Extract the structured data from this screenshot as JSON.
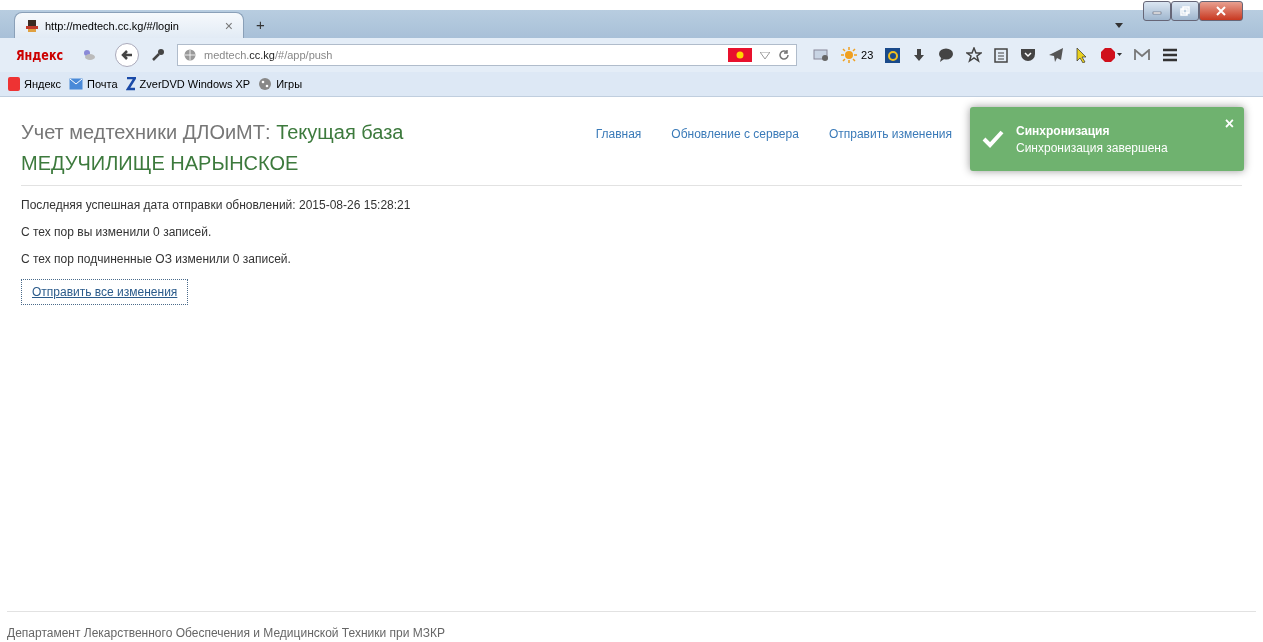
{
  "browser": {
    "tab_title": "http://medtech.cc.kg/#/login",
    "tab_close": "×",
    "new_tab": "+",
    "search_brand": "Яндекс",
    "address_host_prefix": "medtech.",
    "address_host": "cc.kg",
    "address_path": "/#/app/push",
    "weather": "23",
    "bookmarks": [
      {
        "label": "Яндекс"
      },
      {
        "label": "Почта"
      },
      {
        "label": "ZverDVD Windows XP"
      },
      {
        "label": "Игры"
      }
    ]
  },
  "header": {
    "app_title": "Учет медтехники ДЛОиМТ:",
    "base_label": "Текущая база",
    "org": "МЕДУЧИЛИЩЕ НАРЫНСКОЕ"
  },
  "nav": [
    {
      "label": "Главная"
    },
    {
      "label": "Обновление с сервера"
    },
    {
      "label": "Отправить изменения"
    }
  ],
  "content": {
    "lines": [
      "Последняя успешная дата отправки обновлений: 2015-08-26 15:28:21",
      "С тех пор вы изменили 0 записей.",
      "С тех пор подчиненные ОЗ изменили 0 записей."
    ],
    "button": "Отправить все изменения"
  },
  "toast": {
    "title": "Синхронизация",
    "message": "Синхронизация завершена",
    "close": "×"
  },
  "footer": "Департамент Лекарственного Обеспечения и Медицинской Техники при МЗКР"
}
